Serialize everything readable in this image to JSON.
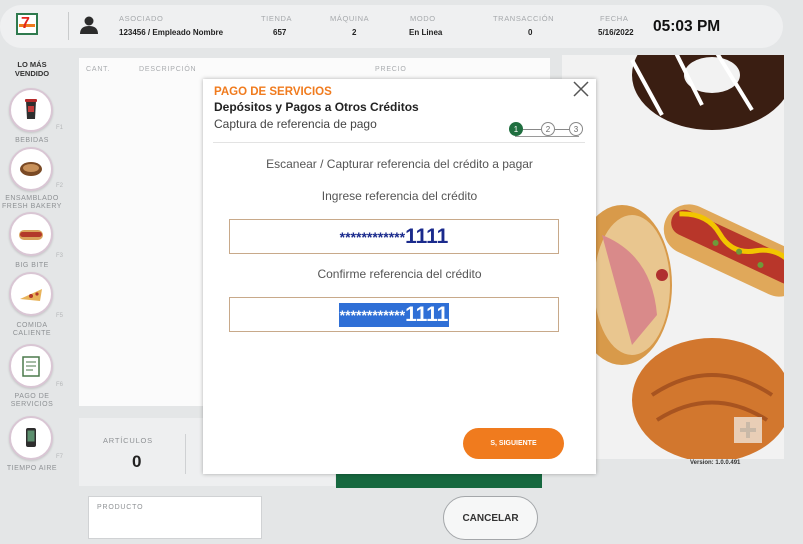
{
  "header": {
    "associate_label": "ASOCIADO",
    "associate_value": "123456 / Empleado Nombre",
    "store_label": "TIENDA",
    "store_value": "657",
    "machine_label": "MÁQUINA",
    "machine_value": "2",
    "mode_label": "MODO",
    "mode_value": "En Linea",
    "transaction_label": "TRANSACCIÓN",
    "transaction_value": "0",
    "date_label": "FECHA",
    "date_value": "5/16/2022",
    "time": "05:03 PM"
  },
  "sidebar": {
    "title": "LO MÁS VENDIDO",
    "items": [
      {
        "label": "BEBIDAS",
        "key": "F1",
        "icon": "drink-cup-icon"
      },
      {
        "label": "ENSAMBLADO FRESH BAKERY",
        "key": "F2",
        "icon": "bakery-icon"
      },
      {
        "label": "BIG BITE",
        "key": "F3",
        "icon": "hotdog-icon"
      },
      {
        "label": "COMIDA CALIENTE",
        "key": "F5",
        "icon": "pizza-icon"
      },
      {
        "label": "PAGO DE SERVICIOS",
        "key": "F6",
        "icon": "bill-icon"
      },
      {
        "label": "TIEMPO AIRE",
        "key": "F7",
        "icon": "phone-icon"
      }
    ]
  },
  "table": {
    "col_qty": "CANT.",
    "col_desc": "DESCRIPCIÓN",
    "col_price": "PRECIO"
  },
  "summary": {
    "articles_label": "ARTÍCULOS",
    "articles_value": "0"
  },
  "product": {
    "label": "PRODUCTO"
  },
  "cancel_button": "CANCELAR",
  "version": "Version: 1.0.0.491",
  "modal": {
    "category": "PAGO DE SERVICIOS",
    "title": "Depósitos y Pagos a Otros Créditos",
    "subtitle": "Captura de referencia de pago",
    "steps": [
      "1",
      "2",
      "3"
    ],
    "active_step": 1,
    "instruction": "Escanear / Capturar referencia del crédito a pagar",
    "ref_label": "Ingrese referencia del crédito",
    "ref_mask": "************",
    "ref_digits": "1111",
    "confirm_label": "Confirme referencia del crédito",
    "confirm_mask": "************",
    "confirm_digits": "1111",
    "next_button": "S, SIGUIENTE"
  },
  "colors": {
    "brand_orange": "#f07b1e",
    "brand_green": "#16683f",
    "masked_text": "#1a2a8c",
    "selection": "#2f6fd6",
    "next_button": "#f07b1e"
  }
}
